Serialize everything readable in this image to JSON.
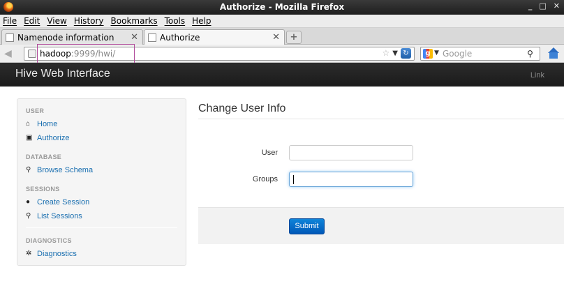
{
  "window": {
    "title": "Authorize - Mozilla Firefox",
    "controls": [
      "_",
      "□",
      "✕"
    ]
  },
  "menu": [
    "File",
    "Edit",
    "View",
    "History",
    "Bookmarks",
    "Tools",
    "Help"
  ],
  "tabs": [
    {
      "label": "Namenode information",
      "active": false
    },
    {
      "label": "Authorize",
      "active": true
    }
  ],
  "newtab_label": "+",
  "navbar": {
    "url_host": "hadoop",
    "url_rest": ":9999/hwi/",
    "search_placeholder": "Google"
  },
  "hive": {
    "brand": "Hive Web Interface",
    "link": "Link"
  },
  "sidebar": {
    "sections": [
      {
        "header": "USER",
        "items": [
          {
            "label": "Home",
            "icon": "home-icon"
          },
          {
            "label": "Authorize",
            "icon": "lock-icon"
          }
        ]
      },
      {
        "header": "DATABASE",
        "items": [
          {
            "label": "Browse Schema",
            "icon": "search-icon"
          }
        ]
      },
      {
        "header": "SESSIONS",
        "items": [
          {
            "label": "Create Session",
            "icon": "user-icon"
          },
          {
            "label": "List Sessions",
            "icon": "search-icon"
          }
        ]
      },
      {
        "header": "DIAGNOSTICS",
        "items": [
          {
            "label": "Diagnostics",
            "icon": "gear-icon"
          }
        ]
      }
    ]
  },
  "form": {
    "title": "Change User Info",
    "user_label": "User",
    "user_value": "",
    "groups_label": "Groups",
    "groups_value": "",
    "submit_label": "Submit"
  },
  "colors": {
    "link": "#1a6fb0",
    "header_bg": "#1b1b1b",
    "submit": "#0058b8",
    "url_highlight": "#b04a9a"
  }
}
